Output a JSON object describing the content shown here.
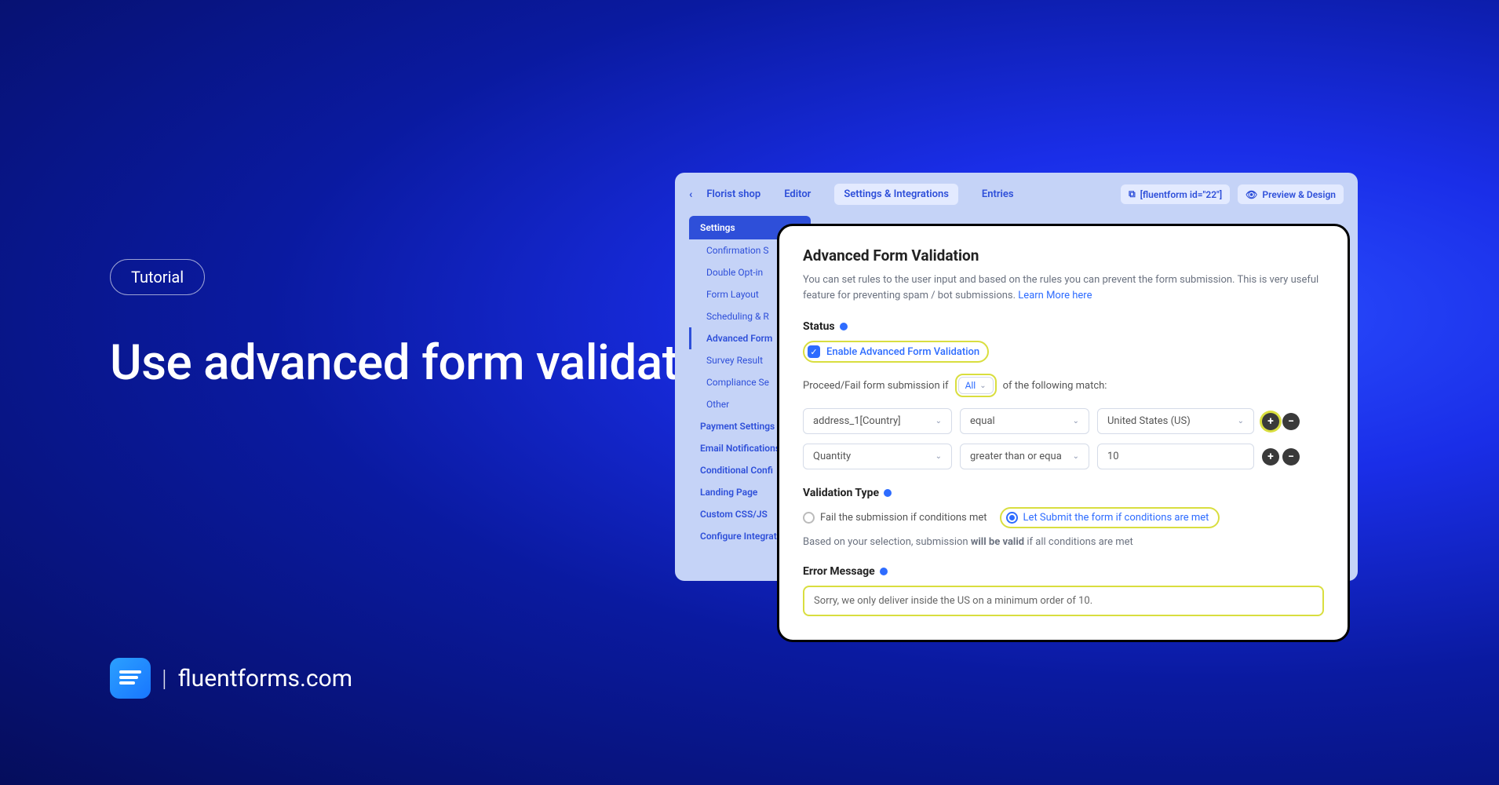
{
  "left": {
    "pill": "Tutorial",
    "headline": "Use advanced form validation in contact forms"
  },
  "footer": {
    "domain": "fluentforms.com"
  },
  "topbar": {
    "back": "‹",
    "formName": "Florist shop",
    "tabs": [
      "Editor",
      "Settings & Integrations",
      "Entries"
    ],
    "activeTab": 1,
    "shortcode": "[fluentform id=\"22\"]",
    "preview": "Preview & Design"
  },
  "sidebar": {
    "header": "Settings",
    "sub": [
      "Confirmation S",
      "Double Opt-in",
      "Form Layout",
      "Scheduling & R",
      "Advanced Form",
      "Survey Result",
      "Compliance Se",
      "Other"
    ],
    "activeSub": 4,
    "main": [
      "Payment Settings",
      "Email Notifications",
      "Conditional Confi",
      "Landing Page",
      "Custom CSS/JS",
      "Configure Integrat"
    ]
  },
  "panel": {
    "title": "Advanced Form Validation",
    "desc": "You can set rules to the user input and based on the rules you can prevent the form submission. This is very useful feature for preventing spam / bot submissions.",
    "learnMore": "Learn More here",
    "statusLabel": "Status",
    "enableLabel": "Enable Advanced Form Validation",
    "matchPrefix": "Proceed/Fail form submission if",
    "matchSelect": "All",
    "matchSuffix": "of the following match:",
    "rules": [
      {
        "field": "address_1[Country]",
        "op": "equal",
        "val": "United States (US)",
        "highlight": true
      },
      {
        "field": "Quantity",
        "op": "greater than or equa",
        "val": "10",
        "highlight": false
      }
    ],
    "validationTypeLabel": "Validation Type",
    "radio1": "Fail the submission if conditions met",
    "radio2": "Let Submit the form if conditions are met",
    "helperPrefix": "Based on your selection, submission",
    "helperBold": "will be valid",
    "helperSuffix": "if all conditions are met",
    "errorLabel": "Error Message",
    "errorValue": "Sorry, we only deliver inside the US on a minimum order of 10."
  }
}
